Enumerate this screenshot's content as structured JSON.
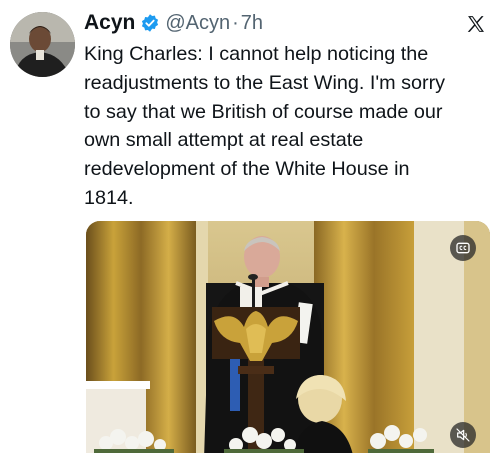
{
  "tweet": {
    "author_name": "Acyn",
    "handle": "@Acyn",
    "separator": "·",
    "time": "7h",
    "text": "King Charles: I cannot help noticing the\nreadjustments to the East Wing. I'm sorry\nto say that we British of course made our\nown small attempt at real estate\nredevelopment of the White House in\n1814."
  },
  "icons": {
    "verified": "verified-badge-icon",
    "platform": "x-logo-icon",
    "captions": "closed-captions-icon",
    "mute": "mute-icon"
  },
  "colors": {
    "verified": "#1d9bf0",
    "secondary_text": "#536471",
    "curtain_gold": "#c9a23a"
  }
}
